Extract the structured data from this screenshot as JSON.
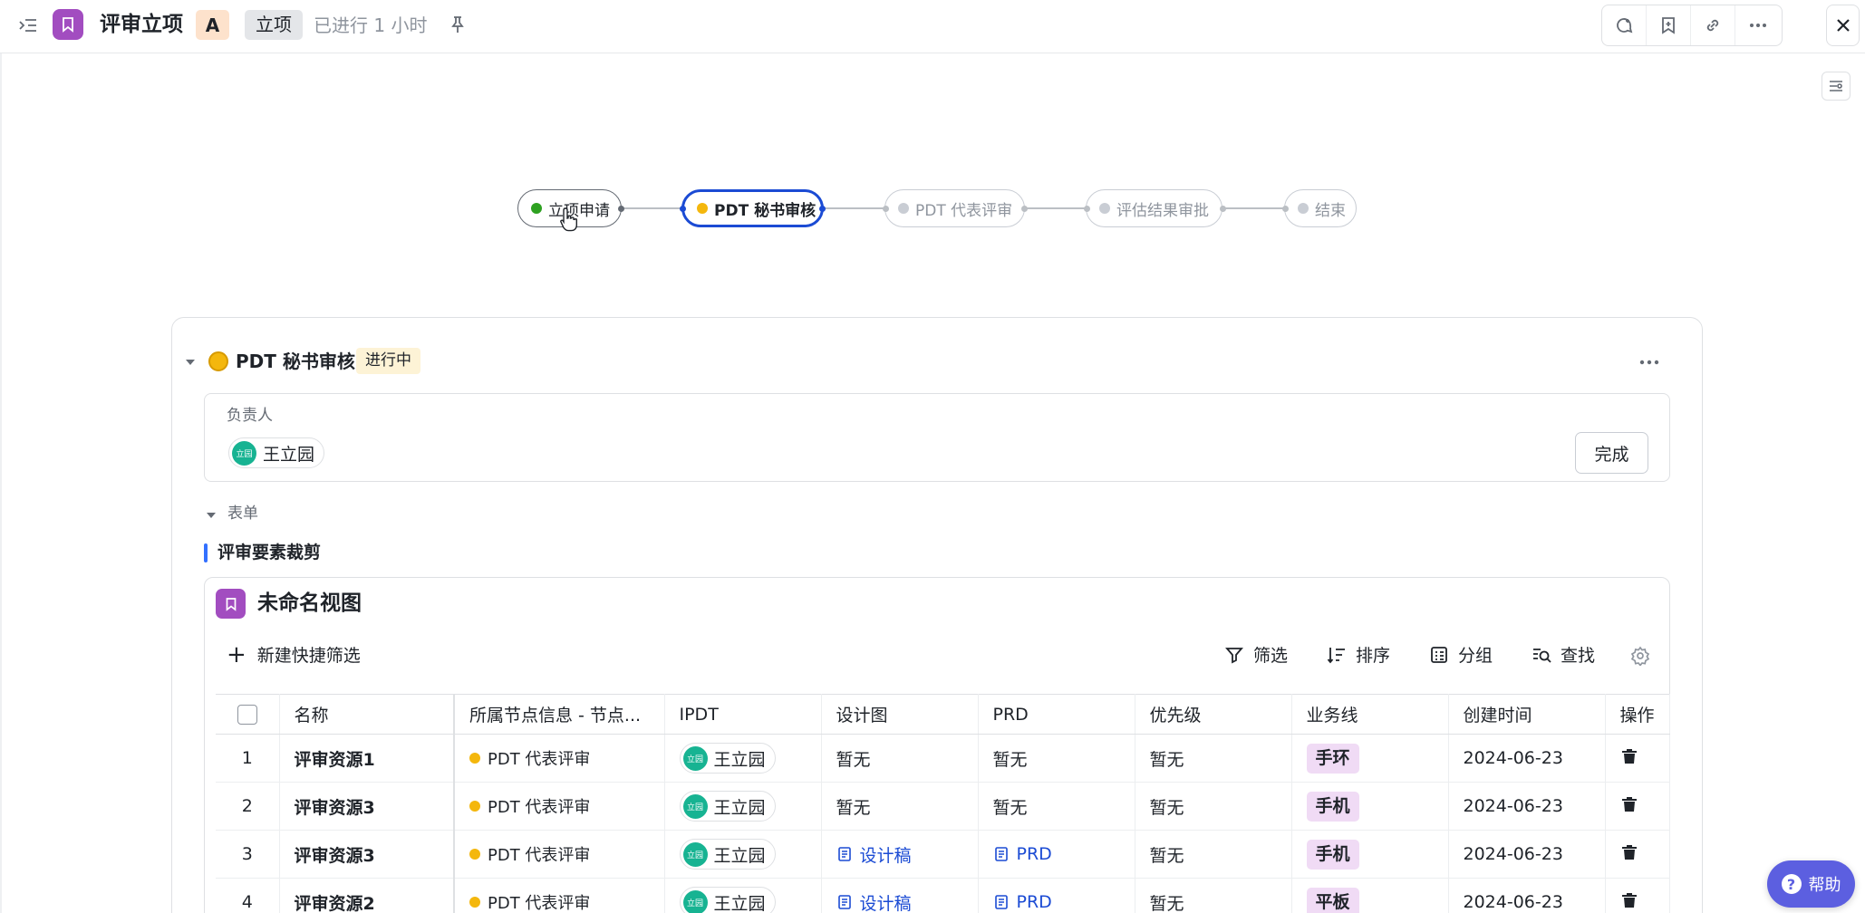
{
  "header": {
    "title": "评审立项",
    "priority": "A",
    "tag": "立项",
    "status": "已进行 1 小时"
  },
  "flow": {
    "nodes": [
      {
        "label": "立项申请",
        "state": "done"
      },
      {
        "label": "PDT 秘书审核",
        "state": "active"
      },
      {
        "label": "PDT 代表评审",
        "state": "pending"
      },
      {
        "label": "评估结果审批",
        "state": "pending"
      },
      {
        "label": "结束",
        "state": "pending"
      }
    ]
  },
  "section": {
    "title": "PDT 秘书审核",
    "badge": "进行中",
    "owner_label": "负责人",
    "owner": {
      "avatar_text": "立园",
      "name": "王立园"
    },
    "done_label": "完成"
  },
  "form": {
    "label": "表单",
    "field_title": "评审要素裁剪"
  },
  "view": {
    "title": "未命名视图",
    "quick_filter": "新建快捷筛选",
    "tools": {
      "filter": "筛选",
      "sort": "排序",
      "group": "分组",
      "search": "查找"
    }
  },
  "table": {
    "columns": [
      "名称",
      "所属节点信息 - 节点...",
      "IPDT",
      "设计图",
      "PRD",
      "优先级",
      "业务线",
      "创建时间",
      "操作"
    ],
    "rows": [
      {
        "idx": "1",
        "name": "评审资源1",
        "node": "PDT 代表评审",
        "ipdt": "王立园",
        "design": "暂无",
        "prd": "暂无",
        "priority": "暂无",
        "line": "手环",
        "created": "2024-06-23"
      },
      {
        "idx": "2",
        "name": "评审资源3",
        "node": "PDT 代表评审",
        "ipdt": "王立园",
        "design": "暂无",
        "prd": "暂无",
        "priority": "暂无",
        "line": "手机",
        "created": "2024-06-23"
      },
      {
        "idx": "3",
        "name": "评审资源3",
        "node": "PDT 代表评审",
        "ipdt": "王立园",
        "design": "设计稿",
        "prd": "PRD",
        "priority": "暂无",
        "line": "手机",
        "created": "2024-06-23"
      },
      {
        "idx": "4",
        "name": "评审资源2",
        "node": "PDT 代表评审",
        "ipdt": "王立园",
        "design": "设计稿",
        "prd": "PRD",
        "priority": "暂无",
        "line": "平板",
        "created": "2024-06-23"
      }
    ]
  },
  "help": {
    "label": "帮助"
  },
  "colors": {
    "accent": "#1b4bd4",
    "app": "#a24dc0",
    "in_progress": "#f4b70d",
    "done": "#2ea121"
  }
}
